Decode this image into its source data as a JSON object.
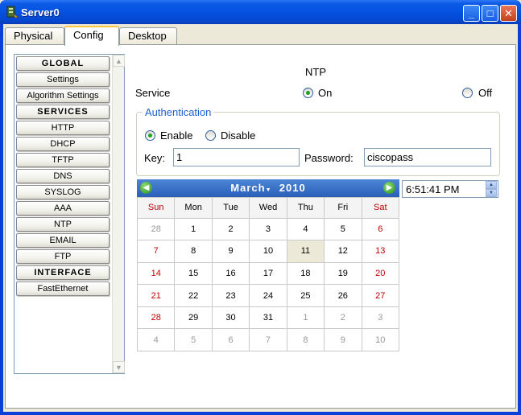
{
  "window": {
    "title": "Server0",
    "buttons": {
      "minimize": "_",
      "maximize": "□",
      "close": "✕"
    }
  },
  "tabs": [
    {
      "label": "Physical"
    },
    {
      "label": "Config"
    },
    {
      "label": "Desktop"
    }
  ],
  "active_tab": "Config",
  "sidebar": {
    "items": [
      {
        "label": "GLOBAL",
        "header": true
      },
      {
        "label": "Settings"
      },
      {
        "label": "Algorithm Settings"
      },
      {
        "label": "SERVICES",
        "header": true
      },
      {
        "label": "HTTP"
      },
      {
        "label": "DHCP"
      },
      {
        "label": "TFTP"
      },
      {
        "label": "DNS"
      },
      {
        "label": "SYSLOG"
      },
      {
        "label": "AAA"
      },
      {
        "label": "NTP"
      },
      {
        "label": "EMAIL"
      },
      {
        "label": "FTP"
      },
      {
        "label": "INTERFACE",
        "header": true
      },
      {
        "label": "FastEthernet"
      }
    ]
  },
  "ntp": {
    "title": "NTP",
    "service_label": "Service",
    "on_label": "On",
    "off_label": "Off",
    "service_selected": "On",
    "auth": {
      "legend": "Authentication",
      "enable_label": "Enable",
      "disable_label": "Disable",
      "selected": "Enable",
      "key_label": "Key:",
      "key_value": "1",
      "password_label": "Password:",
      "password_value": "ciscopass"
    }
  },
  "calendar": {
    "month": "March",
    "year": "2010",
    "days_of_week": [
      "Sun",
      "Mon",
      "Tue",
      "Wed",
      "Thu",
      "Fri",
      "Sat"
    ],
    "weeks": [
      [
        {
          "d": "28",
          "o": true
        },
        {
          "d": "1"
        },
        {
          "d": "2"
        },
        {
          "d": "3"
        },
        {
          "d": "4"
        },
        {
          "d": "5"
        },
        {
          "d": "6"
        }
      ],
      [
        {
          "d": "7"
        },
        {
          "d": "8"
        },
        {
          "d": "9"
        },
        {
          "d": "10"
        },
        {
          "d": "11",
          "today": true
        },
        {
          "d": "12"
        },
        {
          "d": "13"
        }
      ],
      [
        {
          "d": "14"
        },
        {
          "d": "15"
        },
        {
          "d": "16"
        },
        {
          "d": "17"
        },
        {
          "d": "18"
        },
        {
          "d": "19"
        },
        {
          "d": "20"
        }
      ],
      [
        {
          "d": "21"
        },
        {
          "d": "22"
        },
        {
          "d": "23"
        },
        {
          "d": "24"
        },
        {
          "d": "25"
        },
        {
          "d": "26"
        },
        {
          "d": "27"
        }
      ],
      [
        {
          "d": "28"
        },
        {
          "d": "29"
        },
        {
          "d": "30"
        },
        {
          "d": "31"
        },
        {
          "d": "1",
          "o": true
        },
        {
          "d": "2",
          "o": true
        },
        {
          "d": "3",
          "o": true
        }
      ],
      [
        {
          "d": "4",
          "o": true
        },
        {
          "d": "5",
          "o": true
        },
        {
          "d": "6",
          "o": true
        },
        {
          "d": "7",
          "o": true
        },
        {
          "d": "8",
          "o": true
        },
        {
          "d": "9",
          "o": true
        },
        {
          "d": "10",
          "o": true
        }
      ]
    ]
  },
  "time": {
    "value": "6:51:41 PM"
  }
}
